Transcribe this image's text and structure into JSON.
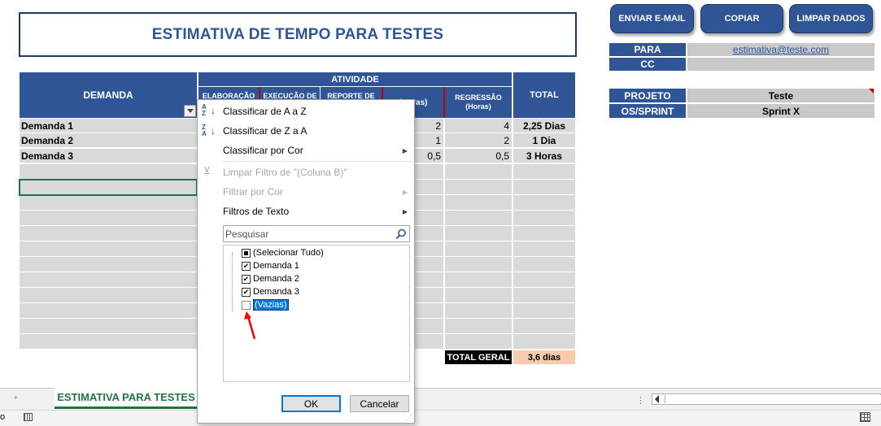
{
  "title": "ESTIMATIVA DE TEMPO PARA TESTES",
  "actions": {
    "email": "ENVIAR E-MAIL",
    "copy": "COPIAR",
    "clear": "LIMPAR DADOS"
  },
  "info": {
    "para_label": "PARA",
    "para_value": "estimativa@teste.com",
    "cc_label": "CC",
    "cc_value": "",
    "projeto_label": "PROJETO",
    "projeto_value": "Teste",
    "os_label": "OS/SPRINT",
    "os_value": "Sprint X"
  },
  "table": {
    "demanda_header": "DEMANDA",
    "atividade_header": "ATIVIDADE",
    "total_header": "TOTAL",
    "sub_headers": [
      "ELABORAÇÃO",
      "EXECUÇÃO DE",
      "REPORTE DE",
      "(Horas)",
      "REGRESSÃO (Horas)"
    ],
    "rows": [
      {
        "name": "Demanda 1",
        "col4": "2",
        "regressao": "4",
        "total": "2,25 Dias"
      },
      {
        "name": "Demanda 2",
        "col4": "1",
        "regressao": "2",
        "total": "1 Dia"
      },
      {
        "name": "Demanda 3",
        "col4": "0,5",
        "regressao": "0,5",
        "total": "3 Horas"
      }
    ],
    "total_geral_label": "TOTAL GERAL",
    "total_geral_value": "3,6 dias"
  },
  "filter_menu": {
    "sort_az": "Classificar de A a Z",
    "sort_za": "Classificar de Z a A",
    "sort_color": "Classificar por Cor",
    "clear_filter": "Limpar Filtro de \"(Coluna B)\"",
    "filter_color": "Filtrar por Cor",
    "text_filters": "Filtros de Texto",
    "search_placeholder": "Pesquisar",
    "items": [
      {
        "label": "(Selecionar Tudo)",
        "state": "partial"
      },
      {
        "label": "Demanda 1",
        "state": "checked"
      },
      {
        "label": "Demanda 2",
        "state": "checked"
      },
      {
        "label": "Demanda 3",
        "state": "checked"
      },
      {
        "label": "(Vazias)",
        "state": "unchecked"
      }
    ],
    "ok": "OK",
    "cancel": "Cancelar"
  },
  "sheet_tab": "ESTIMATIVA PARA TESTES",
  "status_left": "o",
  "colors": {
    "header_blue": "#2f5597",
    "grey_cell": "#d9d9d9",
    "total_geral_bg": "#000000",
    "total_value_bg": "#f8cbad",
    "excel_green": "#217346"
  }
}
